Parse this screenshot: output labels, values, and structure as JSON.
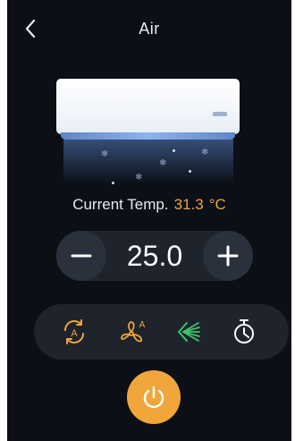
{
  "header": {
    "back_icon": "chevron-left-icon",
    "title": "Air"
  },
  "device": {
    "illustration": "air-conditioner-unit",
    "airflow_icon": "snowflake-icon"
  },
  "current_temp": {
    "label": "Current Temp.",
    "value": "31.3",
    "unit": "°C"
  },
  "setpoint": {
    "value": "25.0",
    "decrease_icon": "minus-icon",
    "increase_icon": "plus-icon"
  },
  "modes": [
    {
      "icon": "auto-mode-icon",
      "color": "#f0a63a"
    },
    {
      "icon": "fan-auto-icon",
      "color": "#f0a63a"
    },
    {
      "icon": "swing-icon",
      "color": "#3ec46d"
    },
    {
      "icon": "timer-icon",
      "color": "#ffffff"
    }
  ],
  "power": {
    "icon": "power-icon",
    "color": "#f0a63a"
  },
  "colors": {
    "background": "#0c0f15",
    "panel": "#1e232c",
    "accent": "#f0a63a",
    "swing_active": "#3ec46d"
  }
}
